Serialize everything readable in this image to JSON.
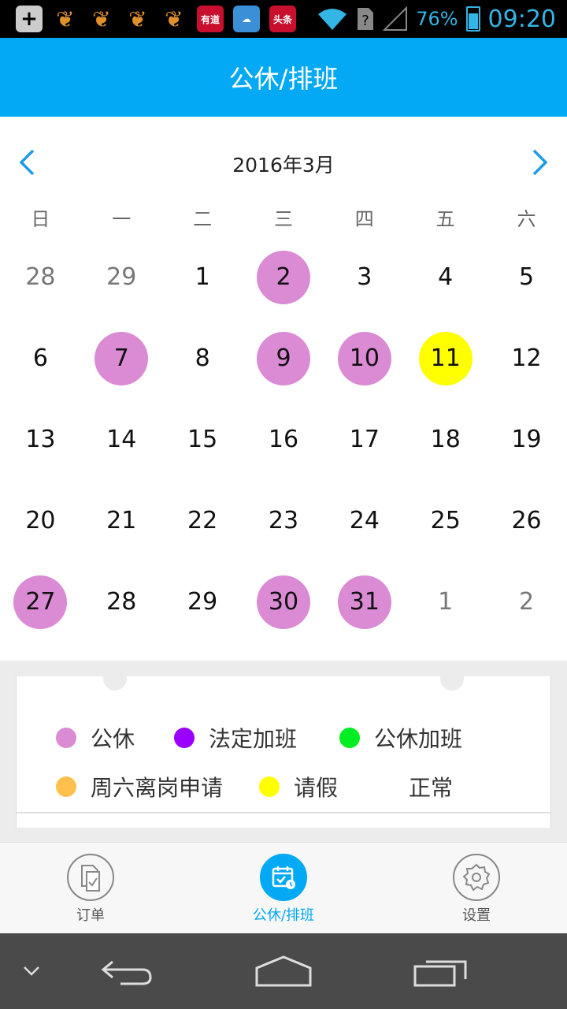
{
  "status_bar": {
    "battery": "76%",
    "time": "09:20",
    "notification_icons": [
      "plus-icon",
      "uc-squirrel-icon",
      "uc-squirrel-icon",
      "uc-squirrel-icon",
      "uc-squirrel-icon",
      "youdao-icon",
      "cloud-icon",
      "toutiao-icon"
    ],
    "youdao_label": "有道",
    "toutiao_label": "头条"
  },
  "header": {
    "title": "公休/排班"
  },
  "calendar": {
    "month_label": "2016年3月",
    "weekdays": [
      "日",
      "一",
      "二",
      "三",
      "四",
      "五",
      "六"
    ],
    "weeks": [
      [
        {
          "d": "28",
          "t": "other"
        },
        {
          "d": "29",
          "t": "other"
        },
        {
          "d": "1",
          "t": ""
        },
        {
          "d": "2",
          "t": "gongxiu"
        },
        {
          "d": "3",
          "t": ""
        },
        {
          "d": "4",
          "t": ""
        },
        {
          "d": "5",
          "t": ""
        }
      ],
      [
        {
          "d": "6",
          "t": ""
        },
        {
          "d": "7",
          "t": "gongxiu"
        },
        {
          "d": "8",
          "t": ""
        },
        {
          "d": "9",
          "t": "gongxiu"
        },
        {
          "d": "10",
          "t": "gongxiu"
        },
        {
          "d": "11",
          "t": "leave"
        },
        {
          "d": "12",
          "t": ""
        }
      ],
      [
        {
          "d": "13",
          "t": ""
        },
        {
          "d": "14",
          "t": ""
        },
        {
          "d": "15",
          "t": ""
        },
        {
          "d": "16",
          "t": ""
        },
        {
          "d": "17",
          "t": ""
        },
        {
          "d": "18",
          "t": ""
        },
        {
          "d": "19",
          "t": ""
        }
      ],
      [
        {
          "d": "20",
          "t": ""
        },
        {
          "d": "21",
          "t": ""
        },
        {
          "d": "22",
          "t": ""
        },
        {
          "d": "23",
          "t": ""
        },
        {
          "d": "24",
          "t": ""
        },
        {
          "d": "25",
          "t": ""
        },
        {
          "d": "26",
          "t": ""
        }
      ],
      [
        {
          "d": "27",
          "t": "gongxiu"
        },
        {
          "d": "28",
          "t": ""
        },
        {
          "d": "29",
          "t": ""
        },
        {
          "d": "30",
          "t": "gongxiu"
        },
        {
          "d": "31",
          "t": "gongxiu"
        },
        {
          "d": "1",
          "t": "other"
        },
        {
          "d": "2",
          "t": "other"
        }
      ]
    ]
  },
  "legend": {
    "row1": [
      {
        "label": "公休",
        "color": "#da8bd4"
      },
      {
        "label": "法定加班",
        "color": "#9b00ff"
      },
      {
        "label": "公休加班",
        "color": "#00ee22"
      }
    ],
    "row2": [
      {
        "label": "周六离岗申请",
        "color": "#ffc04d"
      },
      {
        "label": "请假",
        "color": "#ffff00"
      },
      {
        "label": "正常",
        "color": "#ffffff"
      }
    ]
  },
  "tabbar": {
    "tabs": [
      {
        "label": "订单",
        "icon": "order-icon",
        "active": false
      },
      {
        "label": "公休/排班",
        "icon": "calendar-icon",
        "active": true
      },
      {
        "label": "设置",
        "icon": "gear-icon",
        "active": false
      }
    ]
  },
  "navbar": {
    "icons": [
      "chevron-down-icon",
      "back-icon",
      "home-icon",
      "recent-apps-icon"
    ]
  },
  "colors": {
    "primary": "#03a9f4",
    "gongxiu": "#da8bd4",
    "leave": "#ffff00"
  }
}
